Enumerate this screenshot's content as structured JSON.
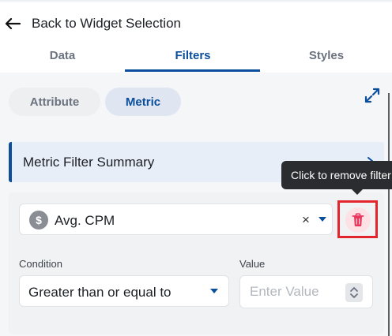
{
  "header": {
    "back_label": "Back to Widget Selection"
  },
  "tabs": [
    {
      "label": "Data",
      "active": false
    },
    {
      "label": "Filters",
      "active": true
    },
    {
      "label": "Styles",
      "active": false
    }
  ],
  "filter_type": {
    "options": [
      "Attribute",
      "Metric"
    ],
    "selected": "Metric"
  },
  "summary": {
    "label": "Metric Filter Summary"
  },
  "metric_filter": {
    "metric_icon_symbol": "$",
    "metric_value": "Avg. CPM",
    "clear_symbol": "×",
    "tooltip": "Click to remove filter",
    "condition_label": "Condition",
    "condition_value": "Greater than or equal to",
    "value_label": "Value",
    "value_placeholder": "Enter Value",
    "value": ""
  },
  "icons": {
    "back": "arrow-left-icon",
    "expand": "expand-icon",
    "summary_chevron": "chevron-right-icon",
    "metric": "dollar-icon",
    "delete": "trash-icon",
    "stepper": "stepper-icon"
  },
  "colors": {
    "accent": "#0b4f9c",
    "summary_bg": "#e8eef8",
    "delete_red": "#e3252d",
    "delete_icon": "#e8365d",
    "tooltip_bg": "#2a2c30",
    "panel_bg": "#f5f6f7"
  }
}
